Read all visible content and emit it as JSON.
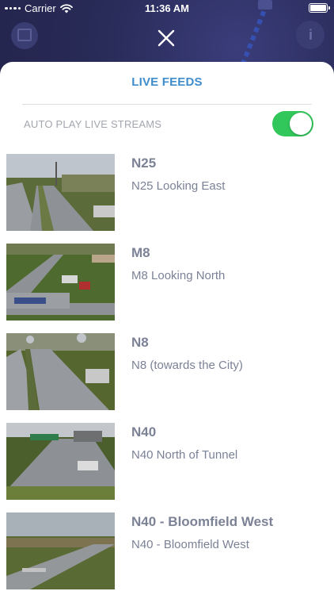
{
  "status_bar": {
    "carrier": "Carrier",
    "time": "11:36 AM"
  },
  "sheet": {
    "title": "LIVE FEEDS",
    "autoplay_label": "AUTO PLAY LIVE STREAMS",
    "autoplay_on": true
  },
  "feeds": [
    {
      "name": "N25",
      "description": "N25 Looking East"
    },
    {
      "name": "M8",
      "description": "M8 Looking North"
    },
    {
      "name": "N8",
      "description": "N8 (towards the City)"
    },
    {
      "name": "N40",
      "description": "N40 North of Tunnel"
    },
    {
      "name": "N40 - Bloomfield West",
      "description": "N40 - Bloomfield West"
    }
  ],
  "colors": {
    "accent": "#3f8dcc",
    "toggle_on": "#32c75a",
    "backdrop": "#2b2d5c"
  }
}
